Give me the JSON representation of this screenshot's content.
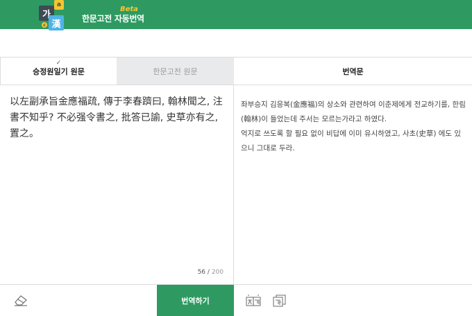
{
  "header": {
    "logo_chars": {
      "main": "가",
      "top": "a",
      "han": "漢",
      "small": "c"
    },
    "title": "한문고전 자동번역",
    "beta": "Beta",
    "accent": "#2e9a62",
    "beta_color": "#f5c62f"
  },
  "source_panel": {
    "tabs": [
      {
        "label": "승정원일기 원문",
        "active": true,
        "check_icon": "✓"
      },
      {
        "label": "한문고전 원문",
        "active": false
      }
    ],
    "text": "以左副承旨金應福疏, 傳于李春躋曰, 翰林聞之, 注書不知乎? 不必强令書之, 批答已諭, 史草亦有之, 置之。",
    "char_count": "56",
    "char_sep": "/",
    "char_max": "200",
    "clear_icon": "eraser-icon",
    "translate_button": "번역하기"
  },
  "target_panel": {
    "title": "번역문",
    "paragraphs": [
      "좌부승지 김응복(金應福)의 상소와 관련하여 이춘제에게 전교하기를, 한림(翰林)이 들었는데 주서는 모르는가라고 하였다.",
      "억지로 쓰도록 할 필요 없이 비답에 이미 유시하였고, 사초(史草) 에도 있으니 그대로 두라."
    ],
    "icons": [
      "hanja-hangul-icon",
      "hangul-copy-icon"
    ]
  }
}
